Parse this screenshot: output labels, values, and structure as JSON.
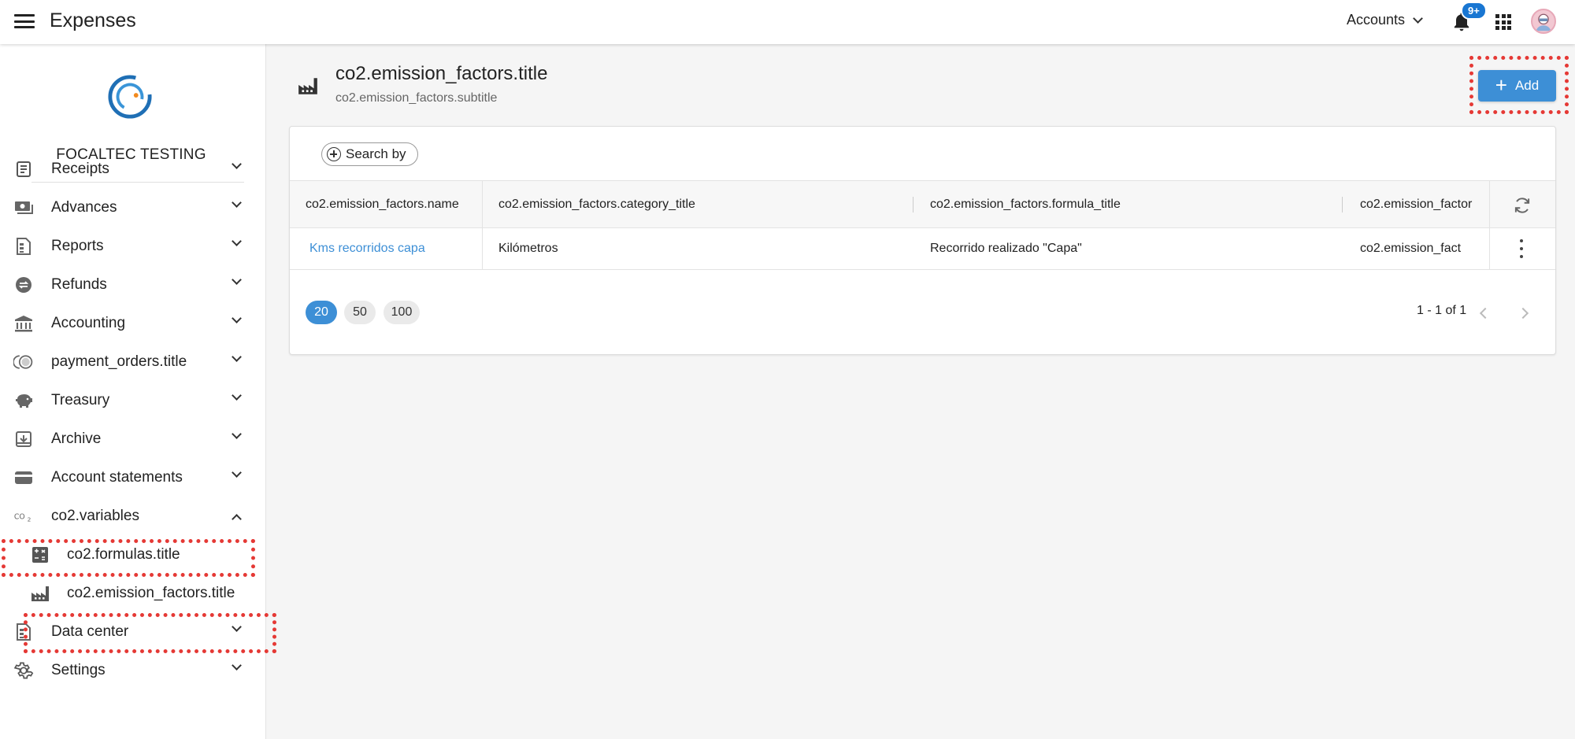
{
  "app": {
    "title": "Expenses"
  },
  "header": {
    "accounts_label": "Accounts",
    "notification_badge": "9+"
  },
  "sidebar": {
    "org_name": "FOCALTEC TESTING",
    "items": [
      {
        "label": "Receipts",
        "icon": "receipt-icon"
      },
      {
        "label": "Advances",
        "icon": "cash-icon"
      },
      {
        "label": "Reports",
        "icon": "report-icon"
      },
      {
        "label": "Refunds",
        "icon": "refund-icon"
      },
      {
        "label": "Accounting",
        "icon": "bank-icon"
      },
      {
        "label": "payment_orders.title",
        "icon": "coins-icon"
      },
      {
        "label": "Treasury",
        "icon": "piggy-bank-icon"
      },
      {
        "label": "Archive",
        "icon": "archive-icon"
      },
      {
        "label": "Account statements",
        "icon": "card-icon"
      },
      {
        "label": "co2.variables",
        "icon": "co2-icon",
        "expanded": true
      },
      {
        "label": "Data center",
        "icon": "data-center-icon"
      },
      {
        "label": "Settings",
        "icon": "gear-icon"
      }
    ],
    "co2_subitems": [
      {
        "label": "co2.formulas.title",
        "icon": "calculator-icon"
      },
      {
        "label": "co2.emission_factors.title",
        "icon": "factory-icon",
        "active": true
      }
    ]
  },
  "page": {
    "title": "co2.emission_factors.title",
    "subtitle": "co2.emission_factors.subtitle",
    "add_label": "Add"
  },
  "toolbar": {
    "search_label": "Search by"
  },
  "table": {
    "columns": [
      "co2.emission_factors.name",
      "co2.emission_factors.category_title",
      "co2.emission_factors.formula_title",
      "co2.emission_factor"
    ],
    "rows": [
      {
        "name": "Kms recorridos capa",
        "category": "Kilómetros",
        "formula": "Recorrido realizado \"Capa\"",
        "factor": "co2.emission_fact"
      }
    ]
  },
  "pagination": {
    "page_sizes": [
      "20",
      "50",
      "100"
    ],
    "selected_size": "20",
    "range_text": "1 - 1 of 1"
  },
  "colors": {
    "accent": "#3d8fd6",
    "highlight": "#e53935"
  }
}
